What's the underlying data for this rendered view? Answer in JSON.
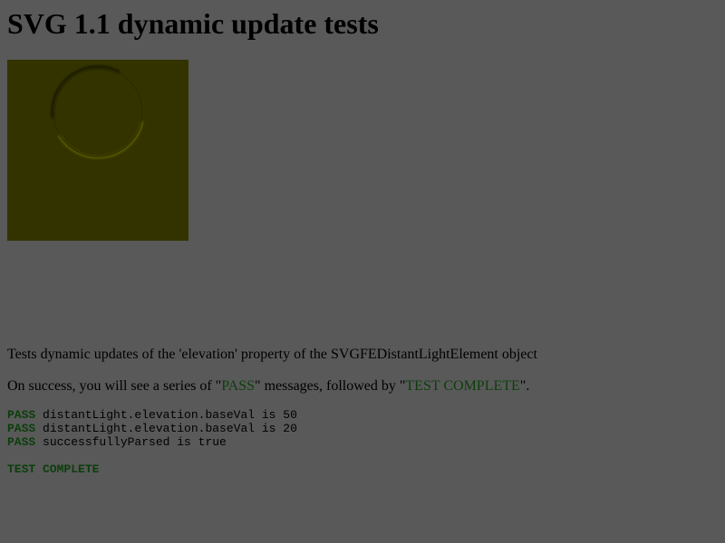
{
  "page": {
    "title": "SVG 1.1 dynamic update tests"
  },
  "description": "Tests dynamic updates of the 'elevation' property of the SVGFEDistantLightElement object",
  "instruction": {
    "prefix": "On success, you will see a series of \"",
    "pass_word": "PASS",
    "middle": "\" messages, followed by \"",
    "complete_word": "TEST COMPLETE",
    "suffix": "\"."
  },
  "results": [
    {
      "status": "PASS",
      "message": " distantLight.elevation.baseVal is 50"
    },
    {
      "status": "PASS",
      "message": " distantLight.elevation.baseVal is 20"
    },
    {
      "status": "PASS",
      "message": " successfullyParsed is true"
    }
  ],
  "footer": {
    "complete": "TEST COMPLETE"
  },
  "colors": {
    "background": "#595959",
    "pass_text": "#0c3e0c",
    "svg_fill": "#333300"
  }
}
